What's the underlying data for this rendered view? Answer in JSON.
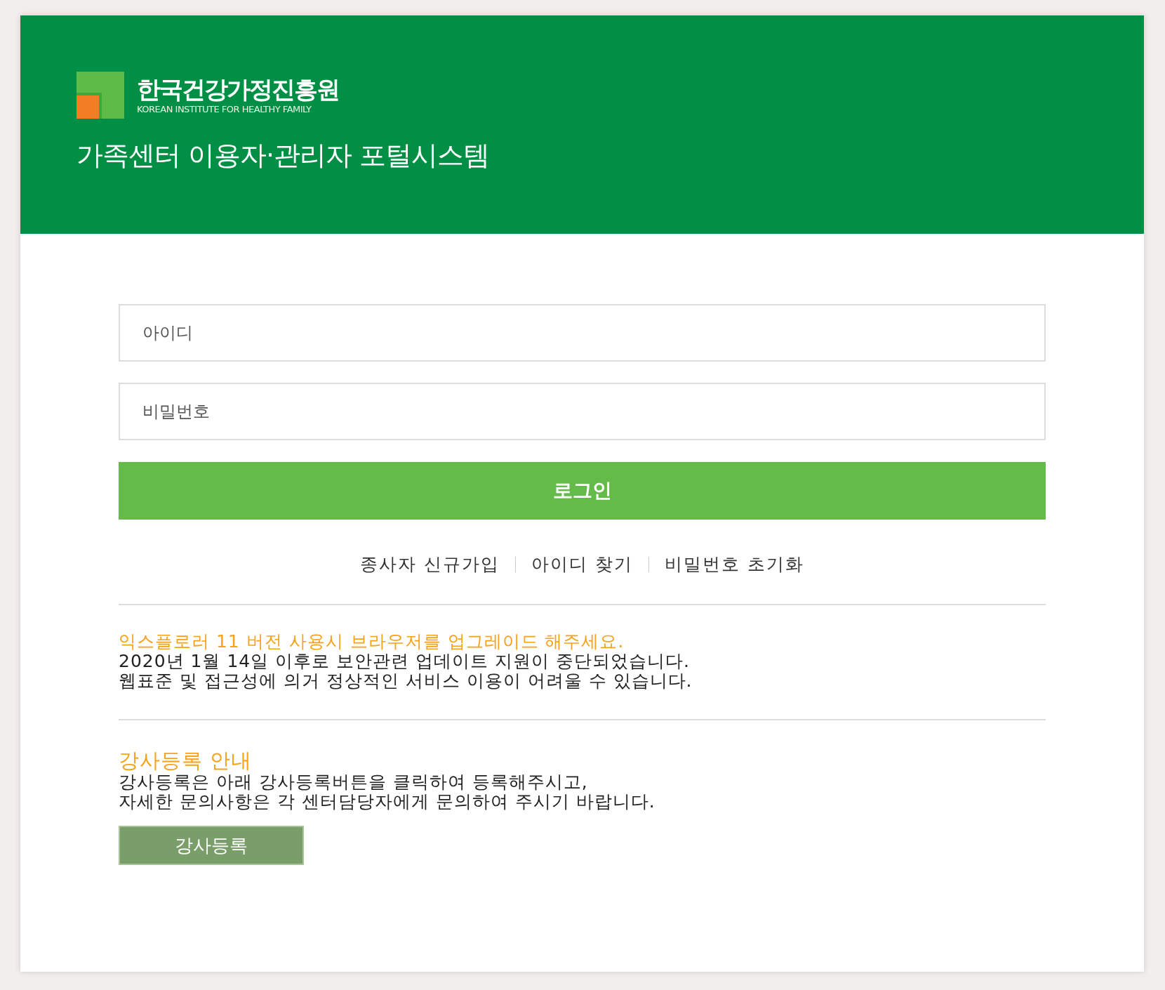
{
  "header": {
    "logo_name": "한국건강가정진흥원",
    "logo_subtitle": "KOREAN INSTITUTE FOR HEALTHY FAMILY",
    "title": "가족센터 이용자·관리자 포털시스템"
  },
  "login": {
    "id_placeholder": "아이디",
    "password_placeholder": "비밀번호",
    "button": "로그인"
  },
  "links": [
    "종사자 신규가입",
    "아이디 찾기",
    "비밀번호 초기화"
  ],
  "notices": [
    {
      "heading": "익스플로러 11 버전 사용시 브라우저를 업그레이드 해주세요.",
      "lines": [
        "2020년 1월 14일 이후로 보안관련 업데이트 지원이 중단되었습니다.",
        "웹표준 및 접근성에 의거 정상적인 서비스 이용이 어려울 수 있습니다."
      ]
    },
    {
      "heading": "강사등록 안내",
      "lines": [
        "강사등록은 아래 강사등록버튼을 클릭하여 등록해주시고,",
        "자세한 문의사항은 각 센터담당자에게 문의하여 주시기 바랍니다."
      ],
      "button": "강사등록"
    }
  ]
}
